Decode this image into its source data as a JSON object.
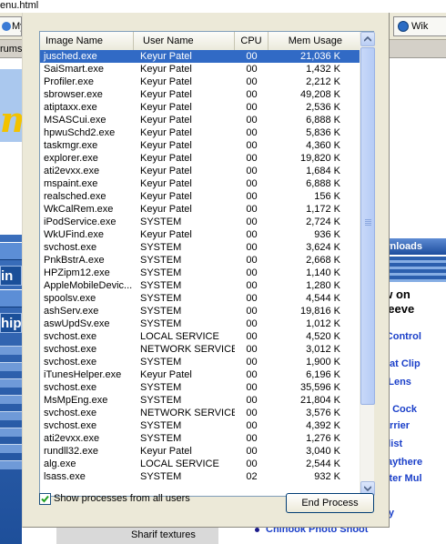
{
  "background_page": {
    "window_title_fragment": "enu.html",
    "tab_left_label": "My",
    "tab_right_label": "Wik",
    "nav_left_text": "rums",
    "banner_letter": "m",
    "left_buttons": [
      "in",
      "hip"
    ],
    "right_column": {
      "bar_label": "wnloads",
      "lines": [
        "ew on",
        "nteeve",
        "o Control",
        ". Hat Clip",
        "el Lens",
        "ter Cock",
        "Carrier",
        "cklist",
        "Staythere",
        "ghter Mul",
        "ility"
      ]
    },
    "bottom_strip_text": "Sharif textures",
    "bottom_link": "Chinook Photo Shoot"
  },
  "task_manager": {
    "columns": {
      "image_name": "Image Name",
      "user_name": "User Name",
      "cpu": "CPU",
      "mem_usage": "Mem Usage"
    },
    "selected_index": 0,
    "processes": [
      {
        "image": "jusched.exe",
        "user": "Keyur Patel",
        "cpu": "00",
        "mem": "21,036 K"
      },
      {
        "image": "SaiSmart.exe",
        "user": "Keyur Patel",
        "cpu": "00",
        "mem": "1,432 K"
      },
      {
        "image": "Profiler.exe",
        "user": "Keyur Patel",
        "cpu": "00",
        "mem": "2,212 K"
      },
      {
        "image": "sbrowser.exe",
        "user": "Keyur Patel",
        "cpu": "00",
        "mem": "49,208 K"
      },
      {
        "image": "atiptaxx.exe",
        "user": "Keyur Patel",
        "cpu": "00",
        "mem": "2,536 K"
      },
      {
        "image": "MSASCui.exe",
        "user": "Keyur Patel",
        "cpu": "00",
        "mem": "6,888 K"
      },
      {
        "image": "hpwuSchd2.exe",
        "user": "Keyur Patel",
        "cpu": "00",
        "mem": "5,836 K"
      },
      {
        "image": "taskmgr.exe",
        "user": "Keyur Patel",
        "cpu": "00",
        "mem": "4,360 K"
      },
      {
        "image": "explorer.exe",
        "user": "Keyur Patel",
        "cpu": "00",
        "mem": "19,820 K"
      },
      {
        "image": "ati2evxx.exe",
        "user": "Keyur Patel",
        "cpu": "00",
        "mem": "1,684 K"
      },
      {
        "image": "mspaint.exe",
        "user": "Keyur Patel",
        "cpu": "00",
        "mem": "6,888 K"
      },
      {
        "image": "realsched.exe",
        "user": "Keyur Patel",
        "cpu": "00",
        "mem": "156 K"
      },
      {
        "image": "WkCalRem.exe",
        "user": "Keyur Patel",
        "cpu": "00",
        "mem": "1,172 K"
      },
      {
        "image": "iPodService.exe",
        "user": "SYSTEM",
        "cpu": "00",
        "mem": "2,724 K"
      },
      {
        "image": "WkUFind.exe",
        "user": "Keyur Patel",
        "cpu": "00",
        "mem": "936 K"
      },
      {
        "image": "svchost.exe",
        "user": "SYSTEM",
        "cpu": "00",
        "mem": "3,624 K"
      },
      {
        "image": "PnkBstrA.exe",
        "user": "SYSTEM",
        "cpu": "00",
        "mem": "2,668 K"
      },
      {
        "image": "HPZipm12.exe",
        "user": "SYSTEM",
        "cpu": "00",
        "mem": "1,140 K"
      },
      {
        "image": "AppleMobileDevic...",
        "user": "SYSTEM",
        "cpu": "00",
        "mem": "1,280 K"
      },
      {
        "image": "spoolsv.exe",
        "user": "SYSTEM",
        "cpu": "00",
        "mem": "4,544 K"
      },
      {
        "image": "ashServ.exe",
        "user": "SYSTEM",
        "cpu": "00",
        "mem": "19,816 K"
      },
      {
        "image": "aswUpdSv.exe",
        "user": "SYSTEM",
        "cpu": "00",
        "mem": "1,012 K"
      },
      {
        "image": "svchost.exe",
        "user": "LOCAL SERVICE",
        "cpu": "00",
        "mem": "4,520 K"
      },
      {
        "image": "svchost.exe",
        "user": "NETWORK SERVICE",
        "cpu": "00",
        "mem": "3,012 K"
      },
      {
        "image": "svchost.exe",
        "user": "SYSTEM",
        "cpu": "00",
        "mem": "1,900 K"
      },
      {
        "image": "iTunesHelper.exe",
        "user": "Keyur Patel",
        "cpu": "00",
        "mem": "6,196 K"
      },
      {
        "image": "svchost.exe",
        "user": "SYSTEM",
        "cpu": "00",
        "mem": "35,596 K"
      },
      {
        "image": "MsMpEng.exe",
        "user": "SYSTEM",
        "cpu": "00",
        "mem": "21,804 K"
      },
      {
        "image": "svchost.exe",
        "user": "NETWORK SERVICE",
        "cpu": "00",
        "mem": "3,576 K"
      },
      {
        "image": "svchost.exe",
        "user": "SYSTEM",
        "cpu": "00",
        "mem": "4,392 K"
      },
      {
        "image": "ati2evxx.exe",
        "user": "SYSTEM",
        "cpu": "00",
        "mem": "1,276 K"
      },
      {
        "image": "rundll32.exe",
        "user": "Keyur Patel",
        "cpu": "00",
        "mem": "3,040 K"
      },
      {
        "image": "alg.exe",
        "user": "LOCAL SERVICE",
        "cpu": "00",
        "mem": "2,544 K"
      },
      {
        "image": "lsass.exe",
        "user": "SYSTEM",
        "cpu": "02",
        "mem": "932 K"
      }
    ],
    "show_all_processes": {
      "label": "Show processes from all users",
      "checked": true
    },
    "end_process_label": "End Process"
  },
  "colors": {
    "selection": "#316ac5",
    "window_face": "#ece9d8",
    "scrollbar_blue": "#b9cdf4"
  }
}
